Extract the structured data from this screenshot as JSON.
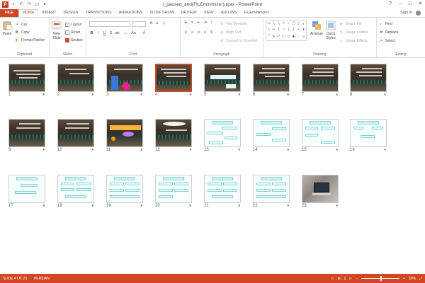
{
  "window": {
    "title": "i_paused_and(FILEminimizer).pptx - PowerPoint",
    "app_logo": "P",
    "controls": [
      "?",
      "–",
      "□",
      "✕"
    ]
  },
  "tabs": [
    {
      "label": "FILE"
    },
    {
      "label": "HOME"
    },
    {
      "label": "INSERT"
    },
    {
      "label": "DESIGN"
    },
    {
      "label": "TRANSITIONS"
    },
    {
      "label": "ANIMATIONS"
    },
    {
      "label": "SLIDE SHOW"
    },
    {
      "label": "REVIEW"
    },
    {
      "label": "VIEW"
    },
    {
      "label": "ADD-INS"
    },
    {
      "label": "FILEminimizer"
    }
  ],
  "signin": "Sign in",
  "ribbon": {
    "clipboard": {
      "label": "Clipboard",
      "paste": "Paste",
      "cut": "Cut",
      "copy": "Copy",
      "format_painter": "Format Painter"
    },
    "slides": {
      "label": "Slides",
      "new_slide": "New",
      "new_slide2": "Slide",
      "layout": "Layout",
      "reset": "Reset",
      "section": "Section"
    },
    "font": {
      "label": "Font"
    },
    "paragraph": {
      "label": "Paragraph",
      "text_direction": "Text Direction",
      "align_text": "Align Text",
      "convert": "Convert to SmartArt"
    },
    "drawing": {
      "label": "Drawing",
      "arrange": "Arrange",
      "quick_styles": "Quick",
      "quick_styles2": "Styles",
      "shape_fill": "Shape Fill",
      "shape_outline": "Shape Outline",
      "shape_effects": "Shape Effects"
    },
    "editing": {
      "label": "Editing",
      "find": "Find",
      "replace": "Replace",
      "select": "Select"
    }
  },
  "slides": [
    {
      "n": "1"
    },
    {
      "n": "2"
    },
    {
      "n": "3"
    },
    {
      "n": "4"
    },
    {
      "n": "5"
    },
    {
      "n": "6"
    },
    {
      "n": "7"
    },
    {
      "n": "8"
    },
    {
      "n": "9"
    },
    {
      "n": "10"
    },
    {
      "n": "11"
    },
    {
      "n": "12"
    },
    {
      "n": "13"
    },
    {
      "n": "14"
    },
    {
      "n": "15"
    },
    {
      "n": "16"
    },
    {
      "n": "17"
    },
    {
      "n": "18"
    },
    {
      "n": "19"
    },
    {
      "n": "20"
    },
    {
      "n": "21"
    },
    {
      "n": "22"
    },
    {
      "n": "23"
    }
  ],
  "status": {
    "slide_info": "SLIDE 4 OF 23",
    "language": "PERSIAN",
    "zoom": "50%"
  },
  "colors": {
    "accent": "#d24726",
    "selected_border": "#d24726"
  }
}
